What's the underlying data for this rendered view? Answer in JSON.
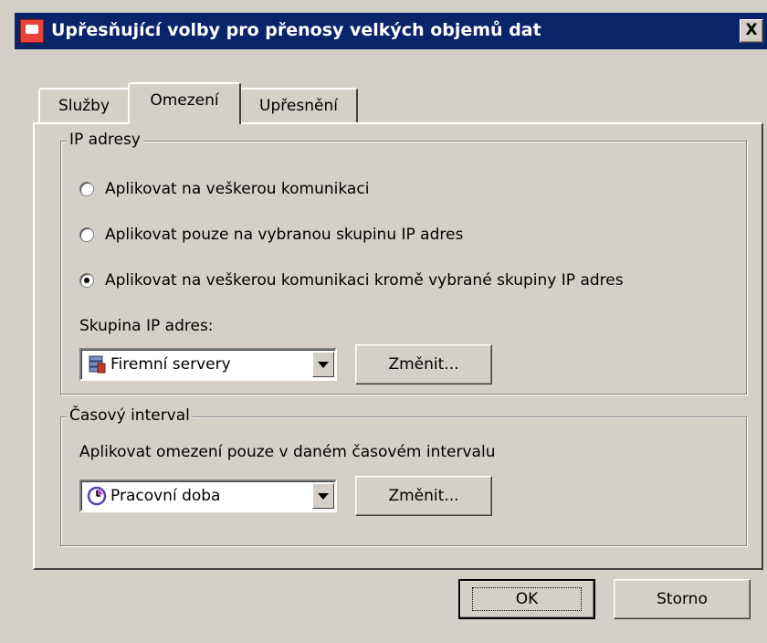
{
  "window": {
    "title": "Upřesňující volby pro přenosy velkých objemů dat",
    "close_label": "X"
  },
  "tabs": [
    {
      "label": "Služby",
      "active": false
    },
    {
      "label": "Omezení",
      "active": true
    },
    {
      "label": "Upřesnění",
      "active": false
    }
  ],
  "ip_group": {
    "legend": "IP adresy",
    "options": [
      {
        "label": "Aplikovat na veškerou komunikaci",
        "checked": false
      },
      {
        "label": "Aplikovat pouze na vybranou skupinu IP adres",
        "checked": false
      },
      {
        "label": "Aplikovat na veškerou komunikaci kromě vybrané skupiny IP adres",
        "checked": true
      }
    ],
    "group_label": "Skupina IP adres:",
    "combo_value": "Firemní servery",
    "change_label": "Změnit..."
  },
  "time_group": {
    "legend": "Časový interval",
    "description": "Aplikovat omezení pouze v daném časovém intervalu",
    "combo_value": "Pracovní doba",
    "change_label": "Změnit..."
  },
  "footer": {
    "ok_label": "OK",
    "cancel_label": "Storno"
  },
  "icons": {
    "title": "app-icon",
    "ip_combo": "server-group-icon",
    "time_combo": "clock-icon"
  }
}
